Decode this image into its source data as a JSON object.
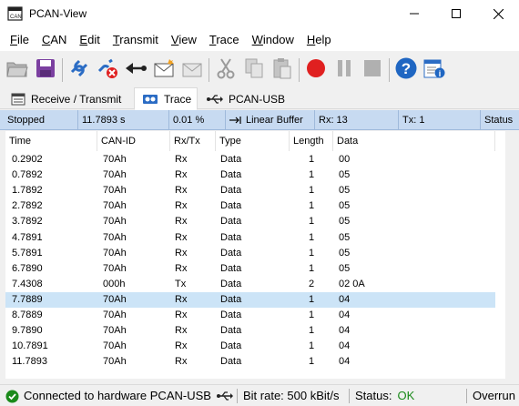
{
  "window": {
    "title": "PCAN-View"
  },
  "menu": [
    {
      "id": "file",
      "label": "File",
      "u": "F",
      "rest": "ile"
    },
    {
      "id": "can",
      "label": "CAN",
      "u": "C",
      "rest": "AN"
    },
    {
      "id": "edit",
      "label": "Edit",
      "u": "E",
      "rest": "dit"
    },
    {
      "id": "transmit",
      "label": "Transmit",
      "u": "T",
      "rest": "ransmit"
    },
    {
      "id": "view",
      "label": "View",
      "u": "V",
      "rest": "iew"
    },
    {
      "id": "trace",
      "label": "Trace",
      "u": "T",
      "rest": "race"
    },
    {
      "id": "window",
      "label": "Window",
      "u": "W",
      "rest": "indow"
    },
    {
      "id": "help",
      "label": "Help",
      "u": "H",
      "rest": "elp"
    }
  ],
  "tabs": [
    {
      "id": "receive-transmit",
      "label": "Receive / Transmit",
      "active": false
    },
    {
      "id": "trace",
      "label": "Trace",
      "active": true
    },
    {
      "id": "pcan-usb",
      "label": "PCAN-USB",
      "active": false
    }
  ],
  "trace_status": {
    "state": "Stopped",
    "elapsed": "11.7893 s",
    "fill": "0.01 %",
    "buffer_mode": "Linear Buffer",
    "rx": "Rx: 13",
    "tx": "Tx: 1",
    "status_label": "Status"
  },
  "columns": [
    "Time",
    "CAN-ID",
    "Rx/Tx",
    "Type",
    "Length",
    "Data"
  ],
  "rows": [
    {
      "time": "0.2902",
      "id": "70Ah",
      "dir": "Rx",
      "type": "Data",
      "len": "1",
      "data": "00"
    },
    {
      "time": "0.7892",
      "id": "70Ah",
      "dir": "Rx",
      "type": "Data",
      "len": "1",
      "data": "05"
    },
    {
      "time": "1.7892",
      "id": "70Ah",
      "dir": "Rx",
      "type": "Data",
      "len": "1",
      "data": "05"
    },
    {
      "time": "2.7892",
      "id": "70Ah",
      "dir": "Rx",
      "type": "Data",
      "len": "1",
      "data": "05"
    },
    {
      "time": "3.7892",
      "id": "70Ah",
      "dir": "Rx",
      "type": "Data",
      "len": "1",
      "data": "05"
    },
    {
      "time": "4.7891",
      "id": "70Ah",
      "dir": "Rx",
      "type": "Data",
      "len": "1",
      "data": "05"
    },
    {
      "time": "5.7891",
      "id": "70Ah",
      "dir": "Rx",
      "type": "Data",
      "len": "1",
      "data": "05"
    },
    {
      "time": "6.7890",
      "id": "70Ah",
      "dir": "Rx",
      "type": "Data",
      "len": "1",
      "data": "05"
    },
    {
      "time": "7.4308",
      "id": "000h",
      "dir": "Tx",
      "type": "Data",
      "len": "2",
      "data": "02 0A"
    },
    {
      "time": "7.7889",
      "id": "70Ah",
      "dir": "Rx",
      "type": "Data",
      "len": "1",
      "data": "04",
      "selected": true
    },
    {
      "time": "8.7889",
      "id": "70Ah",
      "dir": "Rx",
      "type": "Data",
      "len": "1",
      "data": "04"
    },
    {
      "time": "9.7890",
      "id": "70Ah",
      "dir": "Rx",
      "type": "Data",
      "len": "1",
      "data": "04"
    },
    {
      "time": "10.7891",
      "id": "70Ah",
      "dir": "Rx",
      "type": "Data",
      "len": "1",
      "data": "04"
    },
    {
      "time": "11.7893",
      "id": "70Ah",
      "dir": "Rx",
      "type": "Data",
      "len": "1",
      "data": "04"
    }
  ],
  "statusbar": {
    "connection": "Connected to hardware PCAN-USB",
    "bitrate": "Bit rate: 500 kBit/s",
    "status_label": "Status:",
    "status_value": "OK",
    "overrun": "Overrun"
  },
  "colors": {
    "accent_selected_row": "#cce4f7",
    "status_strip": "#c7daf1",
    "status_ok": "#1a8a1a",
    "connected": "#1a8a1a",
    "record": "#e02020",
    "help": "#1f66c2"
  },
  "icons": [
    "app-icon",
    "minimize-icon",
    "maximize-icon",
    "close-icon",
    "open-folder-icon",
    "save-icon",
    "connect-icon",
    "disconnect-icon",
    "reset-icon",
    "new-message-icon",
    "edit-message-icon",
    "cut-icon",
    "copy-icon",
    "paste-icon",
    "record-icon",
    "pause-icon",
    "stop-icon",
    "help-icon",
    "about-icon"
  ]
}
